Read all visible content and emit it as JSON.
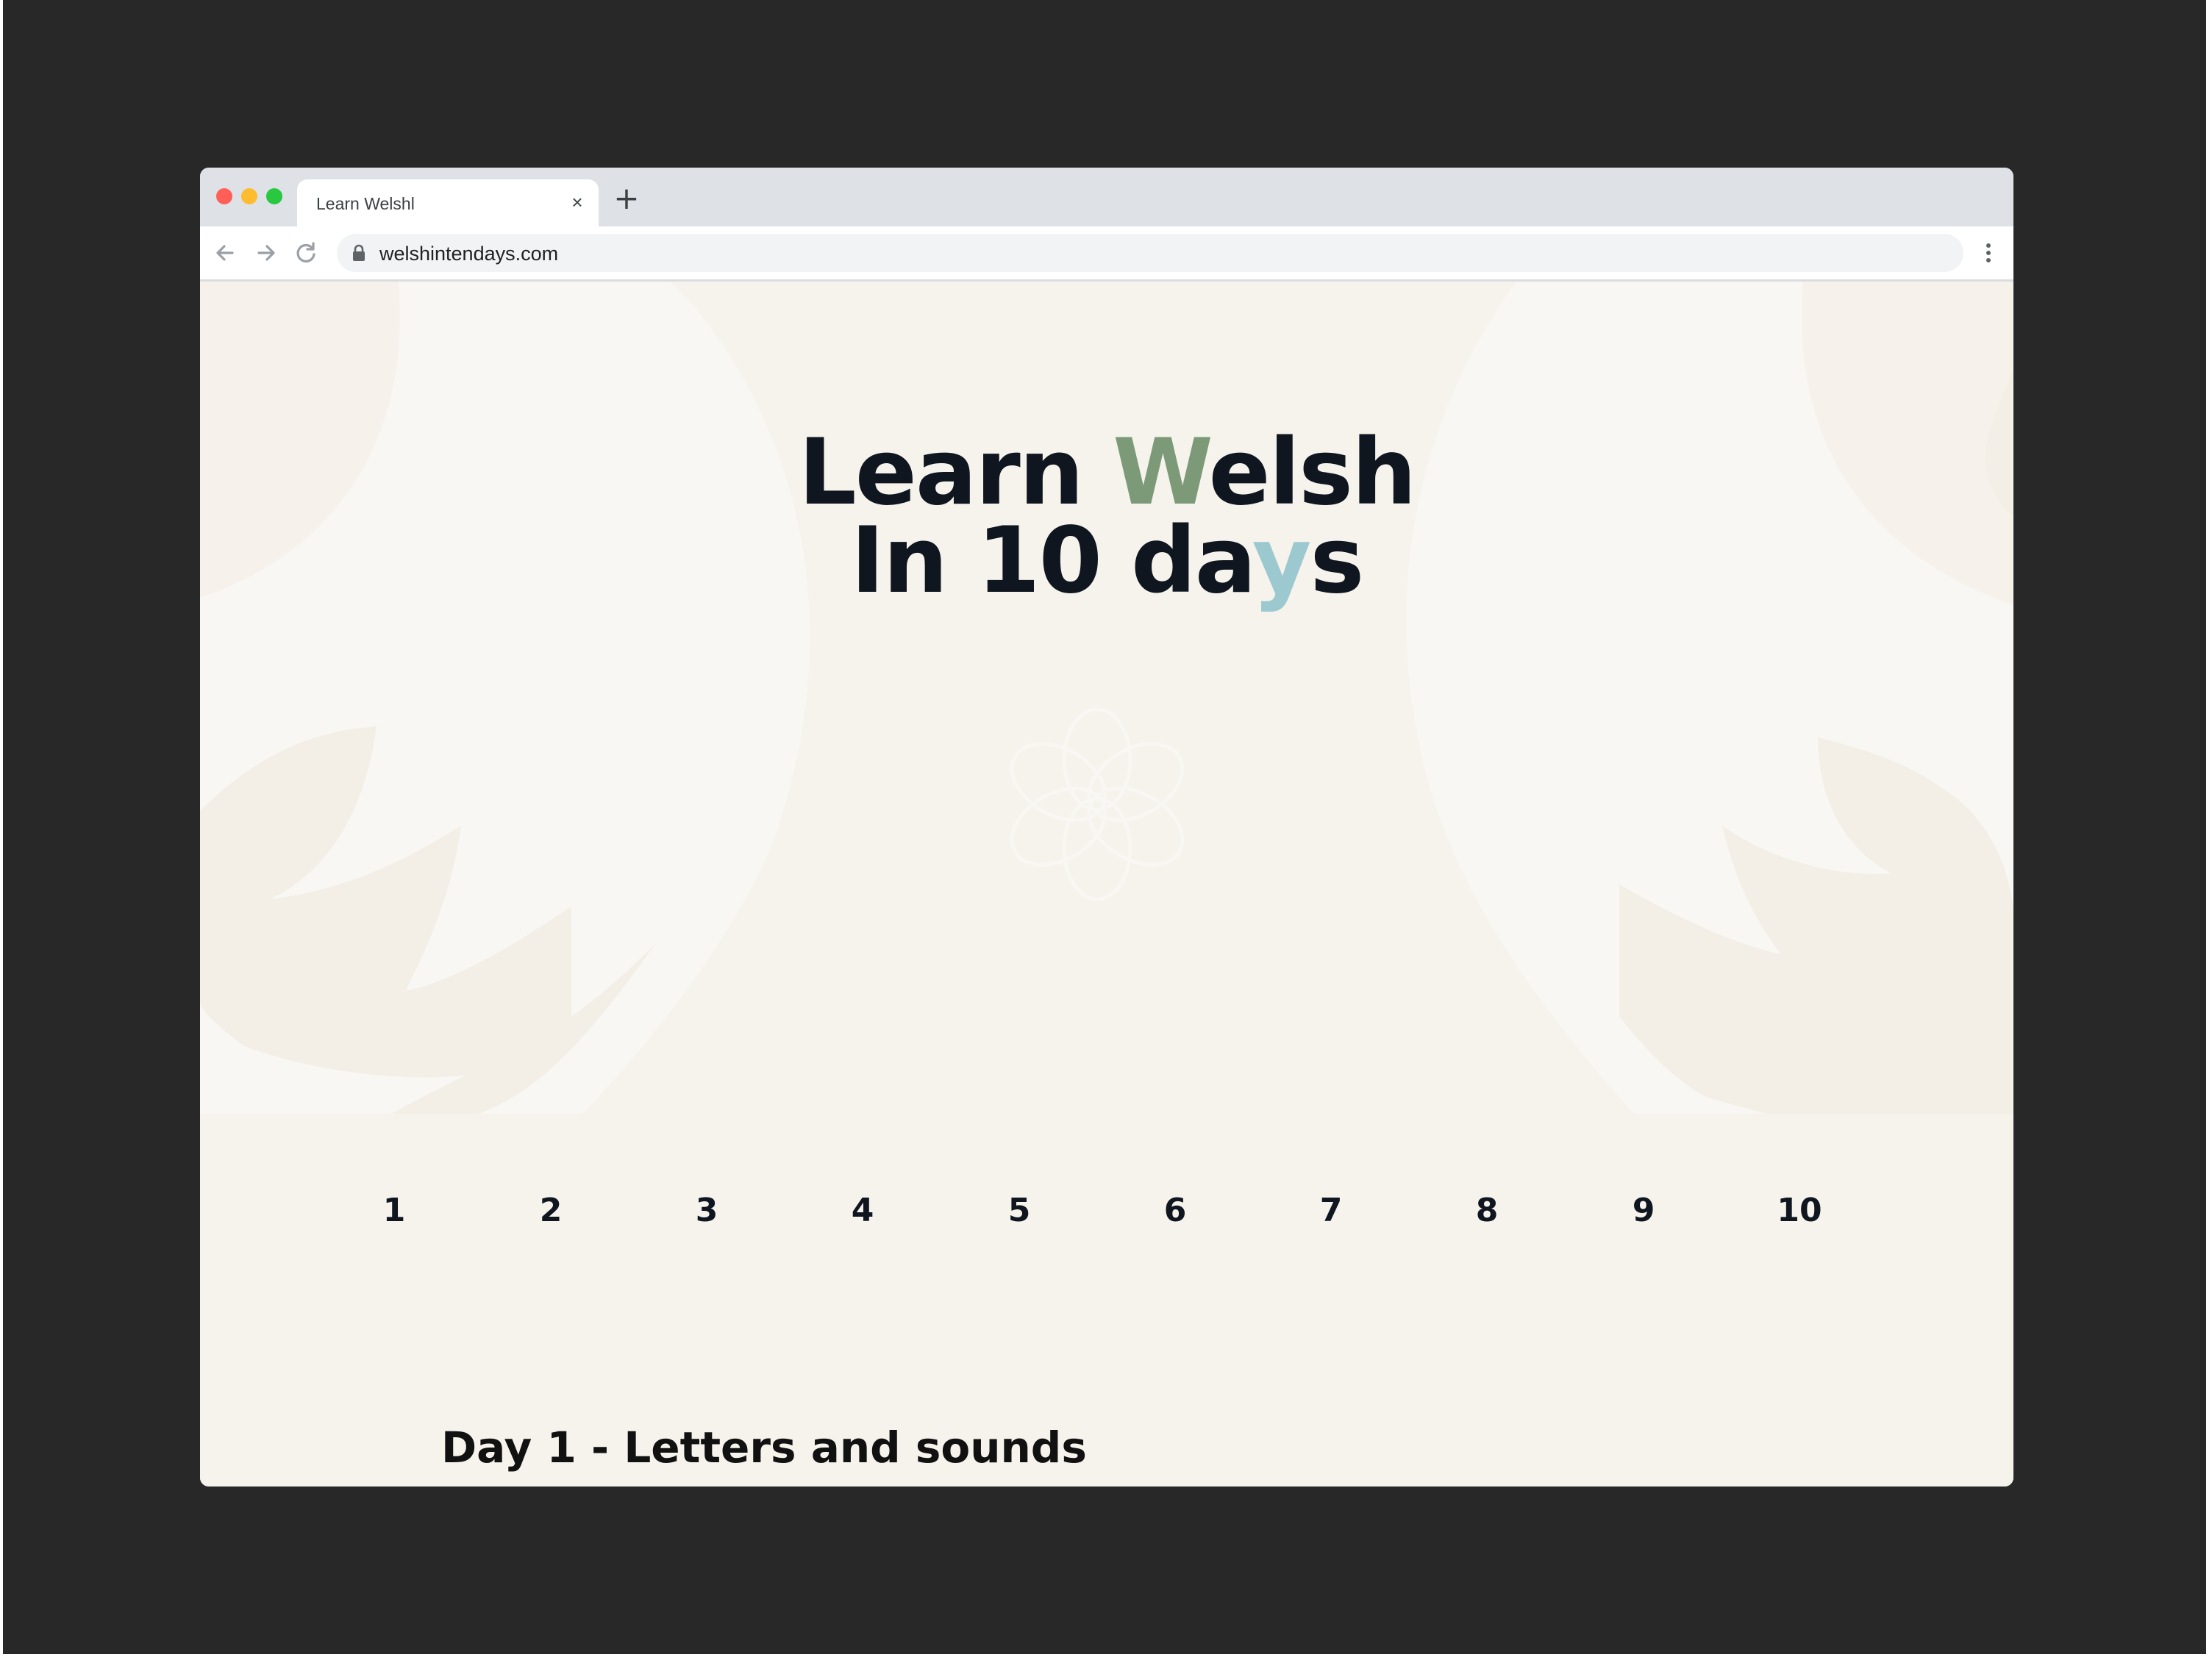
{
  "browser": {
    "tab_title": "Learn Welshl",
    "tab_close": "×",
    "new_tab": "+",
    "url": "welshintendays.com"
  },
  "hero": {
    "title_line1_start": "Learn ",
    "title_line1_accent": "W",
    "title_line1_end": "elsh",
    "title_line2_start": "In 10 da",
    "title_line2_accent": "y",
    "title_line2_end": "s",
    "colors": {
      "text": "#0f1620",
      "accent_w": "#7c9a78",
      "accent_y": "#9cc9d0",
      "background": "#f6f3ec"
    }
  },
  "day_nav": [
    "1",
    "2",
    "3",
    "4",
    "5",
    "6",
    "7",
    "8",
    "9",
    "10"
  ],
  "section": {
    "title": "Day 1 - Letters and sounds"
  },
  "icons": [
    "back-arrow-icon",
    "forward-arrow-icon",
    "reload-icon",
    "lock-icon",
    "more-vertical-icon",
    "flower-logo-icon"
  ]
}
